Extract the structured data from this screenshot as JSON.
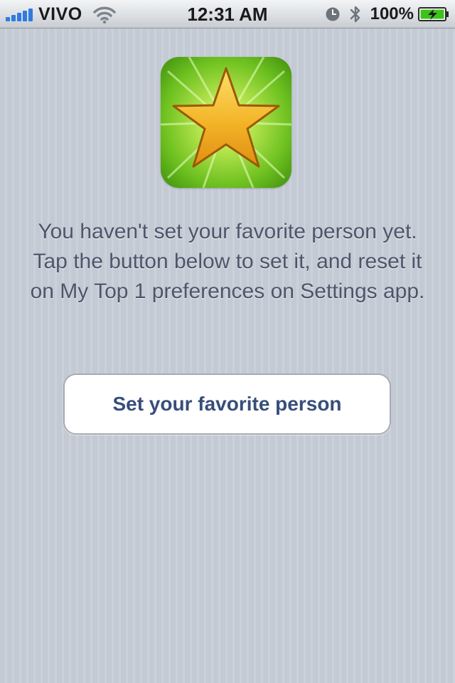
{
  "status_bar": {
    "carrier": "VIVO",
    "time": "12:31 AM",
    "battery_percent": "100%",
    "icons": [
      "signal-bars-icon",
      "wifi-icon",
      "alarm-clock-icon",
      "bluetooth-icon",
      "battery-charging-icon"
    ],
    "signal_color": "#2f7be0",
    "battery_color": "#3cc31a"
  },
  "app_icon": {
    "name": "star-icon",
    "background_color": "#6bbf1e",
    "star_color": "#f3b428"
  },
  "message": {
    "text": "You haven't set your favorite person yet. Tap the button below to set it, and reset it on My Top 1 preferences on Settings app."
  },
  "actions": {
    "set_favorite_label": "Set your favorite person"
  },
  "theme": {
    "background": "#c6ccd6",
    "message_color": "#4c566a",
    "button_text_color": "#374e7a"
  }
}
